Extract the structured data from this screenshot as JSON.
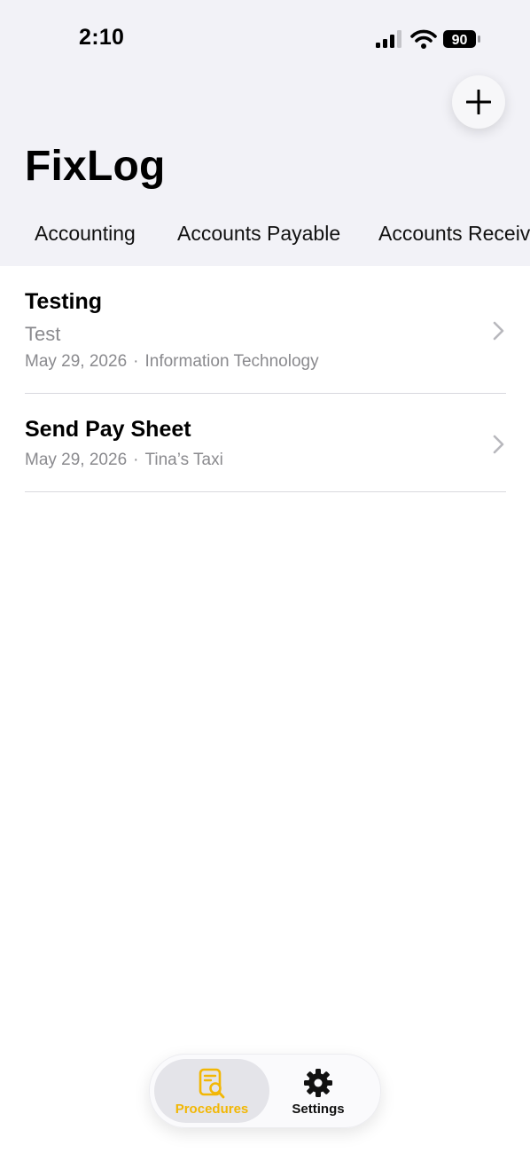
{
  "status_bar": {
    "time": "2:10",
    "battery": "90"
  },
  "header": {
    "title": "FixLog",
    "add_icon": "plus-icon"
  },
  "categories": [
    "Accounting",
    "Accounts Payable",
    "Accounts Receivable"
  ],
  "procedures": [
    {
      "title": "Testing",
      "subtitle": "Test",
      "date": "May 29, 2026",
      "separator": "·",
      "department": "Information Technology"
    },
    {
      "title": "Send Pay Sheet",
      "date": "May 29, 2026",
      "separator": "·",
      "department": "Tina’s Taxi"
    }
  ],
  "tab_bar": {
    "tabs": [
      {
        "label": "Procedures",
        "icon": "document-search-icon",
        "active": true
      },
      {
        "label": "Settings",
        "icon": "gear-icon",
        "active": false
      }
    ]
  },
  "colors": {
    "accent": "#f2b705",
    "header_background": "#f2f2f7",
    "secondary_text": "#8a8a8e"
  }
}
